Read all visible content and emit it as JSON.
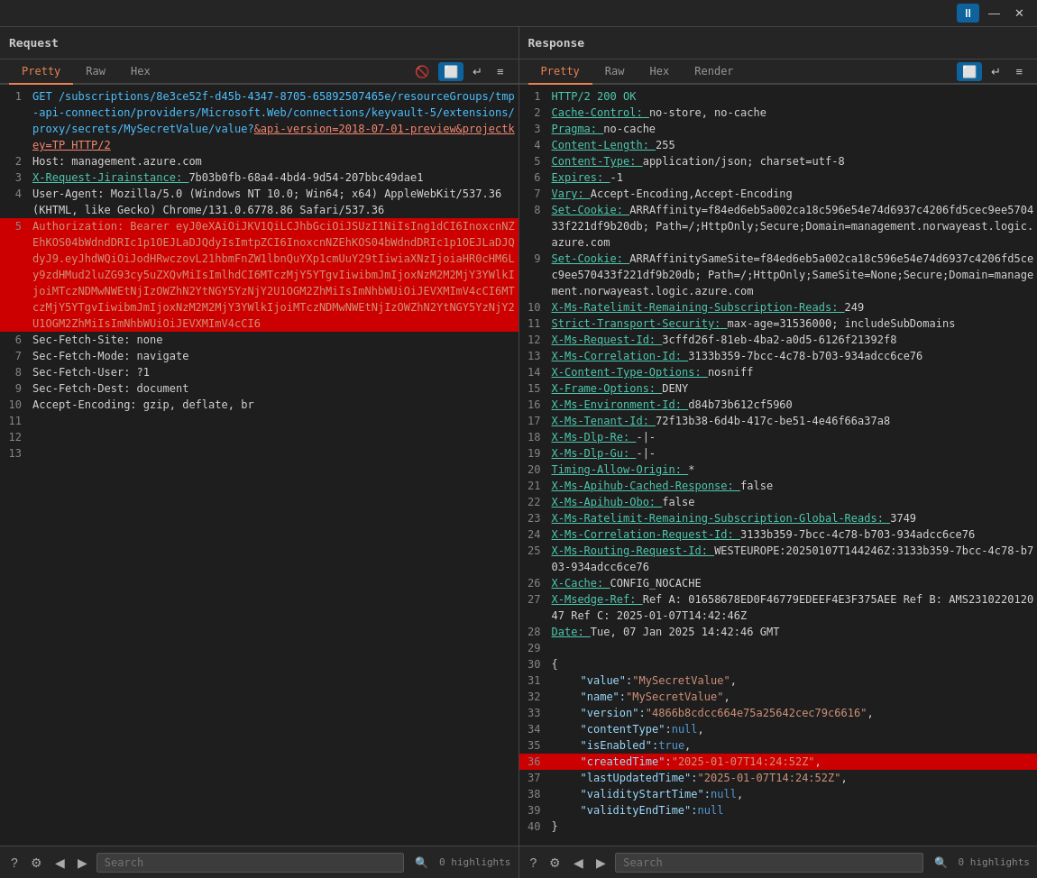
{
  "topControls": {
    "pauseLabel": "⏸",
    "minimizeLabel": "—",
    "closeLabel": "✕"
  },
  "request": {
    "title": "Request",
    "tabs": [
      "Pretty",
      "Raw",
      "Hex"
    ],
    "activeTab": "Pretty",
    "icons": {
      "eye": "👁",
      "wrap": "⏎",
      "more": "≡"
    },
    "lines": [
      {
        "num": 1,
        "parts": [
          {
            "text": "GET /subscriptions/8e3ce52f-d45b-4347-8705-65892507465e/resourceGroups/tmp-api-connection/providers/Microsoft.Web/connections/keyvault-5/extensions/proxy/secrets/MySecretValue/value?",
            "cls": "c-method"
          },
          {
            "text": "&api-version=",
            "cls": "c-red-underline"
          },
          {
            "text": "2018-07-01-preview&projectkey=TP HTTP/2",
            "cls": "c-red-underline"
          }
        ]
      },
      {
        "num": 2,
        "parts": [
          {
            "text": "Host: management.azure.com",
            "cls": "c-plain"
          }
        ]
      },
      {
        "num": 3,
        "parts": [
          {
            "text": "X-Request-Jirainstance: ",
            "cls": "c-cyan-underline"
          },
          {
            "text": "7b03b0fb-68a4-4bd4-9d54-207bbc49dae1",
            "cls": "c-plain"
          }
        ]
      },
      {
        "num": 4,
        "parts": [
          {
            "text": "User-Agent: Mozilla/5.0 (Windows NT 10.0; Win64; x64) AppleWebKit/537.36 (KHTML, like Gecko) Chrome/131.0.6778.86 Safari/537.36",
            "cls": "c-plain"
          }
        ]
      },
      {
        "num": 5,
        "highlight": true,
        "parts": [
          {
            "text": "Authorization: Bearer eyJ0eXAiOiJKV1QiLCJhbGciOiJSUzI1NiIsIng1dCI6InoxcnNZEhKOS04bWdndDRIc1p1OEJLaDJQdyIsImtpZCI6InoxcnNZEhKOS04bWdndDRIc1p1OEJLaDJQdyJ9.eyJhdWQiOiJodHRwczovL21hbmFnZW1lbnQuYXp1cmUuY29tIiwiaXNzIjoiaHR0cHM6Ly9zdHMud2luZG93cy5uZXQvMiIsImlhdCI6MTczMjY5YTgvIiwibmJmIjoxNzM2M2MjY3YWlkIjoiMTczNDMwNWEtNjIzOWZhN2YtNGY5YzNjY2U1OGM2ZhMiIsImNhbWUiOiJEVXMImV4cCI6MTczMjY5YTgvIiwibmJmIjoxNzM2M2MjY3YWlkIjoiMTczNDMwNWEtNjIzOWZhN2YtNGY5YzNjY2U1OGM2ZhMiIsImNhbWUiOiJEVXMImV4cCI6",
            "cls": "c-header-value"
          }
        ]
      },
      {
        "num": 6,
        "parts": [
          {
            "text": "Sec-Fetch-Site: none",
            "cls": "c-plain"
          }
        ]
      },
      {
        "num": 7,
        "parts": [
          {
            "text": "Sec-Fetch-Mode: navigate",
            "cls": "c-plain"
          }
        ]
      },
      {
        "num": 8,
        "parts": [
          {
            "text": "Sec-Fetch-User: ?1",
            "cls": "c-plain"
          }
        ]
      },
      {
        "num": 9,
        "parts": [
          {
            "text": "Sec-Fetch-Dest: document",
            "cls": "c-plain"
          }
        ]
      },
      {
        "num": 10,
        "parts": [
          {
            "text": "Accept-Encoding: gzip, deflate, br",
            "cls": "c-plain"
          }
        ]
      },
      {
        "num": 11,
        "parts": [
          {
            "text": "",
            "cls": "c-plain"
          }
        ]
      },
      {
        "num": 12,
        "parts": [
          {
            "text": "",
            "cls": "c-plain"
          }
        ]
      },
      {
        "num": 13,
        "parts": [
          {
            "text": "",
            "cls": "c-plain"
          }
        ]
      }
    ],
    "bottomBar": {
      "searchPlaceholder": "Search",
      "highlightsPrefix": "0",
      "highlightsSuffix": "highlights",
      "searchIconLabel": "🔍"
    }
  },
  "response": {
    "title": "Response",
    "tabs": [
      "Pretty",
      "Raw",
      "Hex",
      "Render"
    ],
    "activeTab": "Pretty",
    "lines": [
      {
        "num": 1,
        "parts": [
          {
            "text": "HTTP/2 200 OK",
            "cls": "c-status"
          }
        ]
      },
      {
        "num": 2,
        "parts": [
          {
            "text": "Cache-Control: ",
            "cls": "c-cyan-underline"
          },
          {
            "text": "no-store, no-cache",
            "cls": "c-plain"
          }
        ]
      },
      {
        "num": 3,
        "parts": [
          {
            "text": "Pragma: ",
            "cls": "c-cyan-underline"
          },
          {
            "text": "no-cache",
            "cls": "c-plain"
          }
        ]
      },
      {
        "num": 4,
        "parts": [
          {
            "text": "Content-Length: ",
            "cls": "c-cyan-underline"
          },
          {
            "text": "255",
            "cls": "c-plain"
          }
        ]
      },
      {
        "num": 5,
        "parts": [
          {
            "text": "Content-Type: ",
            "cls": "c-cyan-underline"
          },
          {
            "text": "application/json; charset=utf-8",
            "cls": "c-plain"
          }
        ]
      },
      {
        "num": 6,
        "parts": [
          {
            "text": "Expires: ",
            "cls": "c-cyan-underline"
          },
          {
            "text": "-1",
            "cls": "c-plain"
          }
        ]
      },
      {
        "num": 7,
        "parts": [
          {
            "text": "Vary: ",
            "cls": "c-cyan-underline"
          },
          {
            "text": "Accept-Encoding,Accept-Encoding",
            "cls": "c-plain"
          }
        ]
      },
      {
        "num": 8,
        "parts": [
          {
            "text": "Set-Cookie: ",
            "cls": "c-cyan-underline"
          },
          {
            "text": "ARRAffinity=f84ed6eb5a002ca18c596e54e74d6937c4206fd5cec9ee570433f221df9b20db; Path=/;HttpOnly;Secure;Domain=management.norwayeast.logic.azure.com",
            "cls": "c-plain"
          }
        ]
      },
      {
        "num": 9,
        "parts": [
          {
            "text": "Set-Cookie: ",
            "cls": "c-cyan-underline"
          },
          {
            "text": "ARRAffinitySameSite=f84ed6eb5a002ca18c596e54e74d6937c4206fd5cec9ee570433f221df9b20db; Path=/;HttpOnly;SameSite=None;Secure;Domain=management.norwayeast.logic.azure.com",
            "cls": "c-plain"
          }
        ]
      },
      {
        "num": 10,
        "parts": [
          {
            "text": "X-Ms-Ratelimit-Remaining-Subscription-Reads: ",
            "cls": "c-cyan-underline"
          },
          {
            "text": "249",
            "cls": "c-plain"
          }
        ]
      },
      {
        "num": 11,
        "parts": [
          {
            "text": "Strict-Transport-Security: ",
            "cls": "c-cyan-underline"
          },
          {
            "text": "max-age=31536000; includeSubDomains",
            "cls": "c-plain"
          }
        ]
      },
      {
        "num": 12,
        "parts": [
          {
            "text": "X-Ms-Request-Id: ",
            "cls": "c-cyan-underline"
          },
          {
            "text": "3cffd26f-81eb-4ba2-a0d5-6126f21392f8",
            "cls": "c-plain"
          }
        ]
      },
      {
        "num": 13,
        "parts": [
          {
            "text": "X-Ms-Correlation-Id: ",
            "cls": "c-cyan-underline"
          },
          {
            "text": "3133b359-7bcc-4c78-b703-934adcc6ce76",
            "cls": "c-plain"
          }
        ]
      },
      {
        "num": 14,
        "parts": [
          {
            "text": "X-Content-Type-Options: ",
            "cls": "c-cyan-underline"
          },
          {
            "text": "nosniff",
            "cls": "c-plain"
          }
        ]
      },
      {
        "num": 15,
        "parts": [
          {
            "text": "X-Frame-Options: ",
            "cls": "c-cyan-underline"
          },
          {
            "text": "DENY",
            "cls": "c-plain"
          }
        ]
      },
      {
        "num": 16,
        "parts": [
          {
            "text": "X-Ms-Environment-Id: ",
            "cls": "c-cyan-underline"
          },
          {
            "text": "d84b73b612cf5960",
            "cls": "c-plain"
          }
        ]
      },
      {
        "num": 17,
        "parts": [
          {
            "text": "X-Ms-Tenant-Id: ",
            "cls": "c-cyan-underline"
          },
          {
            "text": "72f13b38-6d4b-417c-be51-4e46f66a37a8",
            "cls": "c-plain"
          }
        ]
      },
      {
        "num": 18,
        "parts": [
          {
            "text": "X-Ms-Dlp-Re: ",
            "cls": "c-cyan-underline"
          },
          {
            "text": "-|-",
            "cls": "c-plain"
          }
        ]
      },
      {
        "num": 19,
        "parts": [
          {
            "text": "X-Ms-Dlp-Gu: ",
            "cls": "c-cyan-underline"
          },
          {
            "text": "-|-",
            "cls": "c-plain"
          }
        ]
      },
      {
        "num": 20,
        "parts": [
          {
            "text": "Timing-Allow-Origin: ",
            "cls": "c-cyan-underline"
          },
          {
            "text": "*",
            "cls": "c-plain"
          }
        ]
      },
      {
        "num": 21,
        "parts": [
          {
            "text": "X-Ms-Apihub-Cached-Response: ",
            "cls": "c-cyan-underline"
          },
          {
            "text": "false",
            "cls": "c-plain"
          }
        ]
      },
      {
        "num": 22,
        "parts": [
          {
            "text": "X-Ms-Apihub-Obo: ",
            "cls": "c-cyan-underline"
          },
          {
            "text": "false",
            "cls": "c-plain"
          }
        ]
      },
      {
        "num": 23,
        "parts": [
          {
            "text": "X-Ms-Ratelimit-Remaining-Subscription-Global-Reads: ",
            "cls": "c-cyan-underline"
          },
          {
            "text": "3749",
            "cls": "c-plain"
          }
        ]
      },
      {
        "num": 24,
        "parts": [
          {
            "text": "X-Ms-Correlation-Request-Id: ",
            "cls": "c-cyan-underline"
          },
          {
            "text": "3133b359-7bcc-4c78-b703-934adcc6ce76",
            "cls": "c-plain"
          }
        ]
      },
      {
        "num": 25,
        "parts": [
          {
            "text": "X-Ms-Routing-Request-Id: ",
            "cls": "c-cyan-underline"
          },
          {
            "text": "WESTEUROPE:20250107T144246Z:3133b359-7bcc-4c78-b703-934adcc6ce76",
            "cls": "c-plain"
          }
        ]
      },
      {
        "num": 26,
        "parts": [
          {
            "text": "X-Cache: ",
            "cls": "c-cyan-underline"
          },
          {
            "text": "CONFIG_NOCACHE",
            "cls": "c-plain"
          }
        ]
      },
      {
        "num": 27,
        "parts": [
          {
            "text": "X-Msedge-Ref: ",
            "cls": "c-cyan-underline"
          },
          {
            "text": "Ref A: 01658678ED0F46779EDEEF4E3F375AEE Ref B: AMS231022012047 Ref C: 2025-01-07T14:42:46Z",
            "cls": "c-plain"
          }
        ]
      },
      {
        "num": 28,
        "parts": [
          {
            "text": "Date: ",
            "cls": "c-cyan-underline"
          },
          {
            "text": "Tue, 07 Jan 2025 14:42:46 GMT",
            "cls": "c-plain"
          }
        ]
      },
      {
        "num": 29,
        "parts": [
          {
            "text": "",
            "cls": "c-plain"
          }
        ]
      },
      {
        "num": 30,
        "parts": [
          {
            "text": "{",
            "cls": "c-plain"
          }
        ]
      },
      {
        "num": 31,
        "indent": true,
        "parts": [
          {
            "text": "\"value\":",
            "cls": "c-key"
          },
          {
            "text": "\"MySecretValue\"",
            "cls": "c-string"
          },
          {
            "text": ",",
            "cls": "c-plain"
          }
        ]
      },
      {
        "num": 32,
        "indent": true,
        "parts": [
          {
            "text": "\"name\":",
            "cls": "c-key"
          },
          {
            "text": "\"MySecretValue\"",
            "cls": "c-string"
          },
          {
            "text": ",",
            "cls": "c-plain"
          }
        ]
      },
      {
        "num": 33,
        "indent": true,
        "parts": [
          {
            "text": "\"version\":",
            "cls": "c-key"
          },
          {
            "text": "\"4866b8cdcc664e75a25642cec79c6616\"",
            "cls": "c-string"
          },
          {
            "text": ",",
            "cls": "c-plain"
          }
        ]
      },
      {
        "num": 34,
        "indent": true,
        "parts": [
          {
            "text": "\"contentType\":",
            "cls": "c-key"
          },
          {
            "text": "null",
            "cls": "c-keyword"
          },
          {
            "text": ",",
            "cls": "c-plain"
          }
        ]
      },
      {
        "num": 35,
        "indent": true,
        "parts": [
          {
            "text": "\"isEnabled\":",
            "cls": "c-key"
          },
          {
            "text": "true",
            "cls": "c-keyword"
          },
          {
            "text": ",",
            "cls": "c-plain"
          }
        ]
      },
      {
        "num": 36,
        "indent": true,
        "highlight": true,
        "parts": [
          {
            "text": "\"createdTime\":",
            "cls": "c-key"
          },
          {
            "text": "\"2025-01-07T14:24:52Z\"",
            "cls": "c-string"
          },
          {
            "text": ",",
            "cls": "c-plain"
          }
        ]
      },
      {
        "num": 37,
        "indent": true,
        "parts": [
          {
            "text": "\"lastUpdatedTime\":",
            "cls": "c-key"
          },
          {
            "text": "\"2025-01-07T14:24:52Z\"",
            "cls": "c-string"
          },
          {
            "text": ",",
            "cls": "c-plain"
          }
        ]
      },
      {
        "num": 38,
        "indent": true,
        "parts": [
          {
            "text": "\"validityStartTime\":",
            "cls": "c-key"
          },
          {
            "text": "null",
            "cls": "c-keyword"
          },
          {
            "text": ",",
            "cls": "c-plain"
          }
        ]
      },
      {
        "num": 39,
        "indent": true,
        "parts": [
          {
            "text": "\"validityEndTime\":",
            "cls": "c-key"
          },
          {
            "text": "null",
            "cls": "c-keyword"
          }
        ]
      },
      {
        "num": 40,
        "parts": [
          {
            "text": "}",
            "cls": "c-plain"
          }
        ]
      }
    ],
    "bottomBar": {
      "searchPlaceholder": "Search",
      "highlightsPrefix": "0",
      "highlightsSuffix": "highlights",
      "searchIconLabel": "🔍"
    }
  }
}
